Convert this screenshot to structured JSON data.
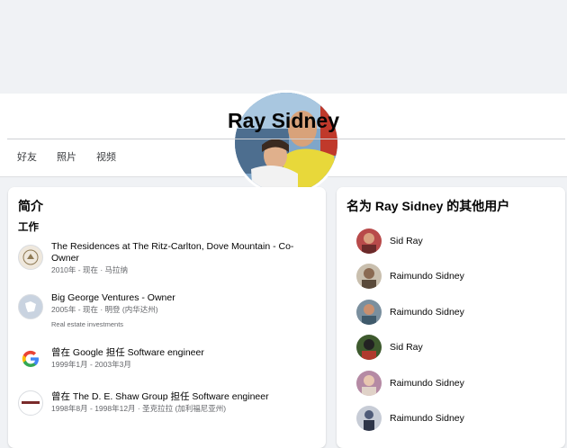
{
  "profile": {
    "name": "Ray Sidney"
  },
  "tabs": [
    {
      "label": "好友"
    },
    {
      "label": "照片"
    },
    {
      "label": "视频"
    }
  ],
  "intro": {
    "title": "简介",
    "work_heading": "工作",
    "items": [
      {
        "icon": "ritz-carlton-logo-icon",
        "title": "The Residences at The Ritz-Carlton, Dove Mountain - Co-Owner",
        "detail": "2010年 - 现在 · 马拉纳",
        "extra": ""
      },
      {
        "icon": "map-outline-icon",
        "title": "Big George Ventures - Owner",
        "detail": "2005年 - 现在 · 明登 (内华达州)",
        "extra": "Real estate investments"
      },
      {
        "icon": "google-logo-icon",
        "title": "曾在 Google 担任 Software engineer",
        "detail": "1999年1月 - 2003年3月",
        "extra": ""
      },
      {
        "icon": "de-shaw-logo-icon",
        "title": "曾在 The D. E. Shaw Group 担任 Software engineer",
        "detail": "1998年8月 - 1998年12月 · 圣克拉拉 (加利福尼亚州)",
        "extra": ""
      }
    ]
  },
  "others": {
    "title": "名为 Ray Sidney 的其他用户",
    "people": [
      {
        "name": "Sid Ray",
        "avatar_color": "#b84a4a"
      },
      {
        "name": "Raimundo Sidney",
        "avatar_color": "#8a6a52"
      },
      {
        "name": "Raimundo Sidney",
        "avatar_color": "#7a8f9e"
      },
      {
        "name": "Sid Ray",
        "avatar_color": "#3e5a2e"
      },
      {
        "name": "Raimundo Sidney",
        "avatar_color": "#b58aa4"
      },
      {
        "name": "Raimundo Sidney",
        "avatar_color": "#4f5b78"
      }
    ]
  },
  "colors": {
    "page_bg": "#f0f2f5",
    "card_bg": "#ffffff",
    "secondary_text": "#65676b"
  }
}
